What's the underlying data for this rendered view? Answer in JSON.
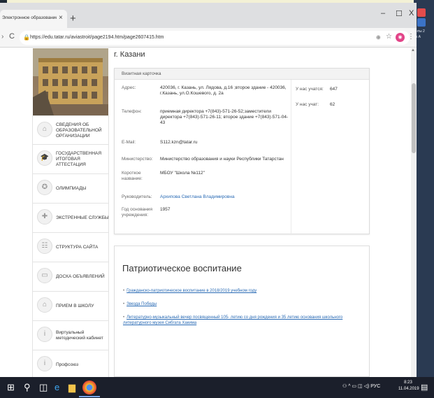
{
  "browser": {
    "tab_title": "Электронное образование в Ре",
    "new_tab": "+",
    "url": "https://edu.tatar.ru/aviastroit/page2194.htm/page2607415.htm",
    "window_controls": {
      "minimize": "–",
      "maximize": "☐",
      "close": "X"
    }
  },
  "page": {
    "school_city": "г. Казани",
    "card": {
      "header": "Визитная карточка",
      "fields": [
        {
          "label": "Адрес:",
          "value": "420036, г. Казань, ул. Лядова, д.16 ;второе здание - 420036, г.Казань, ул.О.Кошевого, д. 2а"
        },
        {
          "label": "Телефон:",
          "value": "приемная директора +7(843)-571-26-52;заместители директора +7(843)-571-26-11; второе здание +7(843)-571-04-43"
        },
        {
          "label": "E-Mail:",
          "value": "S112.kzn@tatar.ru"
        },
        {
          "label": "Министерство:",
          "value": "Министерство образования и науки Республики Татарстан"
        },
        {
          "label": "Короткое название:",
          "value": "МБОУ \"Школа №112\""
        },
        {
          "label": "Руководитель:",
          "value": "Архипова Светлана Владимировна"
        },
        {
          "label": "Год основания учреждения:",
          "value": "1957"
        }
      ],
      "stats": [
        {
          "label": "У нас учатся:",
          "value": "647"
        },
        {
          "label": "У нас учат:",
          "value": "62"
        }
      ]
    },
    "patriot": {
      "title": "Патриотическое воспитание",
      "links": [
        "Гражданско-патриотическое воспитание в 2018/2019 учебном году",
        "Звезда Победы",
        "Литературно-музыкальный вечер посвященный 105- летию со дня рождения и 35 летию основания школьного литературного музея Сибгата Хакима"
      ]
    }
  },
  "sidebar": {
    "items": [
      {
        "label": "СВЕДЕНИЯ ОБ ОБРАЗОВАТЕЛЬНОЙ ОРГАНИЗАЦИИ",
        "icon": "building-icon"
      },
      {
        "label": "ГОСУДАРСТВЕННАЯ ИТОГОВАЯ АТТЕСТАЦИЯ",
        "icon": "graduation-cap-icon"
      },
      {
        "label": "ОЛИМПИАДЫ",
        "icon": "medal-icon"
      },
      {
        "label": "ЭКСТРЕННЫЕ СЛУЖБЫ",
        "icon": "first-aid-icon"
      },
      {
        "label": "СТРУКТУРА САЙТА",
        "icon": "sitemap-icon"
      },
      {
        "label": "ДОСКА ОБЪЯВЛЕНИЙ",
        "icon": "board-icon"
      },
      {
        "label": "ПРИЕМ В ШКОЛУ",
        "icon": "school-icon"
      },
      {
        "label": "Виртуальный методический кабинет",
        "icon": "info-icon"
      },
      {
        "label": "Профсоюз",
        "icon": "info-icon"
      }
    ]
  },
  "taskbar": {
    "tray_text": "РУС",
    "time": "8:23",
    "date": "11.04.2019"
  },
  "desktop": {
    "labels": [
      "нты 2",
      "к А"
    ]
  },
  "colors": {
    "link": "#2a6bb5",
    "taskbar": "#1b1f2b",
    "desktop_background": "#f3f1d6"
  }
}
